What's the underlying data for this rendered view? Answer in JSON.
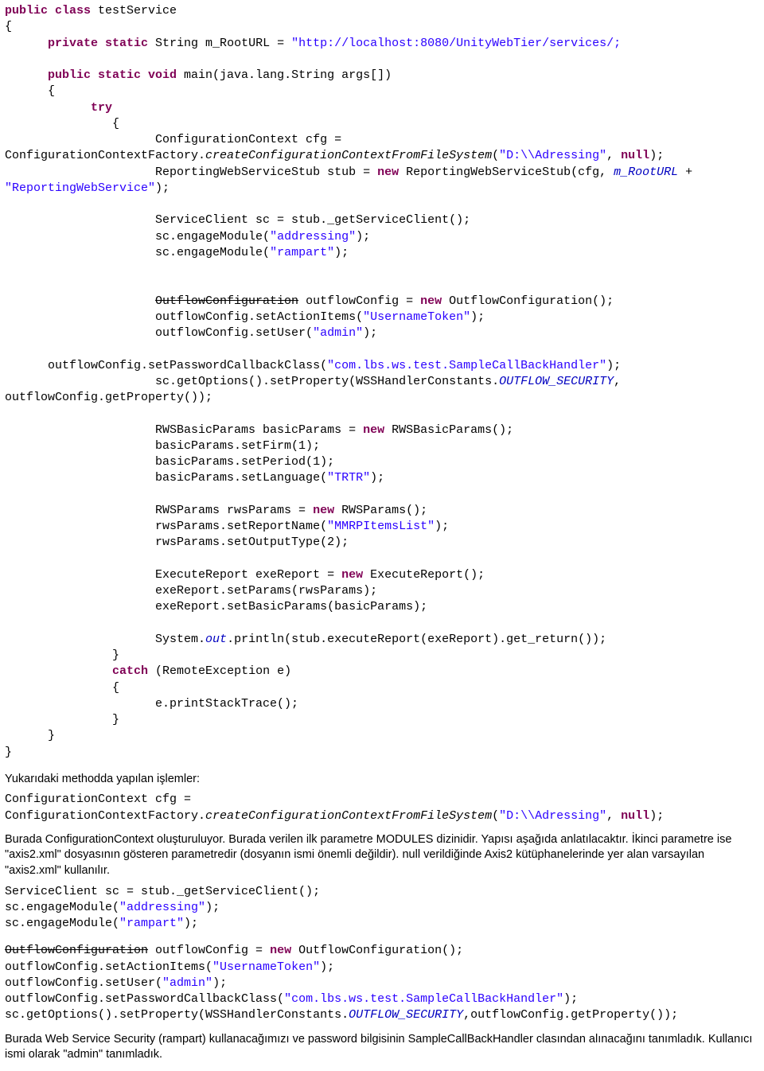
{
  "code_main": {
    "l1": "public class",
    "l1b": " testService",
    "l2": "{",
    "l3a": "      private static",
    "l3b": " String m_RootURL = ",
    "l3c": "\"http://localhost:8080/UnityWebTier/services/;",
    "blank": "",
    "l5a": "      public static void",
    "l5b": " main(java.lang.String args[])",
    "l6": "      {",
    "l7": "            try",
    "l8": "               {",
    "l9": "                     ConfigurationContext cfg = ConfigurationContextFactory.",
    "l9b": "createConfigurationContextFromFileSystem",
    "l9c": "(",
    "l9d": "\"D:\\\\Adressing\"",
    "l9e": ", ",
    "l9f": "null",
    "l9g": ");",
    "l10a": "                     ReportingWebServiceStub stub = ",
    "l10b": "new",
    "l10c": " ReportingWebServiceStub(cfg, ",
    "l10d": "m_RootURL",
    "l10e": " + ",
    "l10f": "\"ReportingWebService\"",
    "l10g": ");",
    "l12": "                     ServiceClient sc = stub._getServiceClient();",
    "l13a": "                     sc.engageModule(",
    "l13b": "\"addressing\"",
    "l13c": ");",
    "l14a": "                     sc.engageModule(",
    "l14b": "\"rampart\"",
    "l14c": ");",
    "l17a": "                     ",
    "l17b": "OutflowConfiguration",
    "l17c": " outflowConfig = ",
    "l17d": "new",
    "l17e": " OutflowConfiguration();",
    "l18a": "                     outflowConfig.setActionItems(",
    "l18b": "\"UsernameToken\"",
    "l18c": ");",
    "l19a": "                     outflowConfig.setUser(",
    "l19b": "\"admin\"",
    "l19c": ");",
    "l21a": "      outflowConfig.setPasswordCallbackClass(",
    "l21b": "\"com.lbs.ws.test.SampleCallBackHandler\"",
    "l21c": ");",
    "l22a": "                     sc.getOptions().setProperty(WSSHandlerConstants.",
    "l22b": "OUTFLOW_SECURITY",
    "l22c": ", outflowConfig.getProperty());",
    "l24a": "                     RWSBasicParams basicParams = ",
    "l24b": "new",
    "l24c": " RWSBasicParams();",
    "l25": "                     basicParams.setFirm(1);",
    "l26": "                     basicParams.setPeriod(1);",
    "l27a": "                     basicParams.setLanguage(",
    "l27b": "\"TRTR\"",
    "l27c": ");",
    "l29a": "                     RWSParams rwsParams = ",
    "l29b": "new",
    "l29c": " RWSParams();",
    "l30a": "                     rwsParams.setReportName(",
    "l30b": "\"MMRPItemsList\"",
    "l30c": ");",
    "l31": "                     rwsParams.setOutputType(2);",
    "l33a": "                     ExecuteReport exeReport = ",
    "l33b": "new",
    "l33c": " ExecuteReport();",
    "l34": "                     exeReport.setParams(rwsParams);",
    "l35": "                     exeReport.setBasicParams(basicParams);",
    "l37a": "                     System.",
    "l37b": "out",
    "l37c": ".println(stub.executeReport(exeReport).get_return());",
    "l38": "               }",
    "l39a": "               ",
    "l39b": "catch",
    "l39c": " (RemoteException e)",
    "l40": "               {",
    "l41": "                     e.printStackTrace();",
    "l42": "               }",
    "l43": "      }",
    "l44": "}"
  },
  "para1": "Yukarıdaki methodda yapılan işlemler:",
  "snippet1": {
    "s1": "ConfigurationContext cfg = ConfigurationContextFactory.",
    "s1b": "createConfigurationContextFromFileSystem",
    "s1c": "(",
    "s1d": "\"D:\\\\Adressing\"",
    "s1e": ", ",
    "s1f": "null",
    "s1g": ");"
  },
  "para2": "Burada ConfigurationContext oluşturuluyor. Burada verilen ilk parametre MODULES dizinidir. Yapısı aşağıda anlatılacaktır. İkinci parametre ise \"axis2.xml\" dosyasının gösteren parametredir (dosyanın ismi önemli değildir). null verildiğinde Axis2 kütüphanelerinde yer alan varsayılan \"axis2.xml\" kullanılır.",
  "snippet2": {
    "s1": "ServiceClient sc = stub._getServiceClient();",
    "s2a": "sc.engageModule(",
    "s2b": "\"addressing\"",
    "s2c": ");",
    "s3a": "sc.engageModule(",
    "s3b": "\"rampart\"",
    "s3c": ");"
  },
  "snippet3": {
    "s1a": "OutflowConfiguration",
    "s1b": " outflowConfig = ",
    "s1c": "new",
    "s1d": " OutflowConfiguration();",
    "s2a": "outflowConfig.setActionItems(",
    "s2b": "\"UsernameToken\"",
    "s2c": ");",
    "s3a": "outflowConfig.setUser(",
    "s3b": "\"admin\"",
    "s3c": ");",
    "s4a": "outflowConfig.setPasswordCallbackClass(",
    "s4b": "\"com.lbs.ws.test.SampleCallBackHandler\"",
    "s4c": ");",
    "s5a": "sc.getOptions().setProperty(WSSHandlerConstants.",
    "s5b": "OUTFLOW_SECURITY",
    "s5c": ",outflowConfig.getProperty());"
  },
  "para3": "Burada Web Service Security (rampart) kullanacağımızı ve password bilgisinin SampleCallBackHandler clasından alınacağını tanımladık. Kullanıcı ismi olarak \"admin\" tanımladık."
}
